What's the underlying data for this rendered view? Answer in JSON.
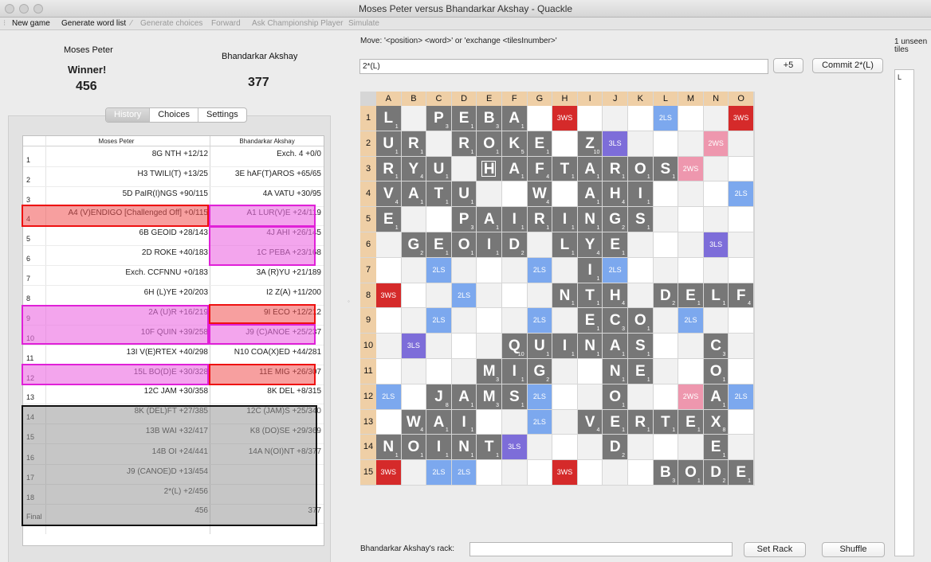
{
  "window": {
    "title": "Moses Peter versus Bhandarkar Akshay - Quackle"
  },
  "toolbar": [
    {
      "label": "New game",
      "enabled": true
    },
    {
      "label": "Generate word list",
      "enabled": true
    },
    {
      "label": "Generate choices",
      "enabled": false
    },
    {
      "label": "Forward",
      "enabled": false
    },
    {
      "label": "Ask Championship Player",
      "enabled": false
    },
    {
      "label": "Simulate",
      "enabled": false
    }
  ],
  "players": {
    "p1": {
      "name": "Moses Peter",
      "status": "Winner!",
      "score": "456"
    },
    "p2": {
      "name": "Bhandarkar Akshay",
      "score": "377"
    }
  },
  "tabs": [
    "History",
    "Choices",
    "Settings"
  ],
  "history": {
    "columns": [
      "Moses Peter",
      "Bhandarkar Akshay"
    ],
    "rows": [
      {
        "n": "1",
        "p1": "8G NTH  +12/12",
        "p2": "Exch. 4   +0/0"
      },
      {
        "n": "2",
        "p1": "H3 TWILI(T)  +13/25",
        "p2": "3E hAF(T)AROS  +65/65"
      },
      {
        "n": "3",
        "p1": "5D PaIR(I)NGS  +90/115",
        "p2": "4A VATU  +30/95"
      },
      {
        "n": "4",
        "p1": "A4 (V)ENDIGO [Challenged Off]  +0/115",
        "p2": "A1 LUR(V)E  +24/119"
      },
      {
        "n": "5",
        "p1": "6B GEOID  +28/143",
        "p2": "4J AHI  +26/145"
      },
      {
        "n": "6",
        "p1": "2D ROKE  +40/183",
        "p2": "1C PEBA  +23/168"
      },
      {
        "n": "7",
        "p1": "Exch. CCFNNU  +0/183",
        "p2": "3A (R)YU  +21/189"
      },
      {
        "n": "8",
        "p1": "6H (L)YE  +20/203",
        "p2": "I2 Z(A)  +11/200"
      },
      {
        "n": "9",
        "p1": "2A (U)R  +16/219",
        "p2": "9I ECO  +12/212"
      },
      {
        "n": "10",
        "p1": "10F QUIN  +39/258",
        "p2": "J9 (C)ANOE  +25/237"
      },
      {
        "n": "11",
        "p1": "13I V(E)RTEX  +40/298",
        "p2": "N10 COA(X)ED  +44/281"
      },
      {
        "n": "12",
        "p1": "15L BO(D)E  +30/328",
        "p2": "11E MIG  +26/307"
      },
      {
        "n": "13",
        "p1": "12C JAM  +30/358",
        "p2": "8K DEL  +8/315"
      },
      {
        "n": "14",
        "p1": "8K (DEL)FT  +27/385",
        "p2": "12C (JAM)S  +25/340"
      },
      {
        "n": "15",
        "p1": "13B WAI  +32/417",
        "p2": "K8 (DO)SE  +29/369"
      },
      {
        "n": "16",
        "p1": "14B OI  +24/441",
        "p2": "14A N(OI)NT  +8/377"
      },
      {
        "n": "17",
        "p1": "J9 (CANOE)D  +13/454",
        "p2": ""
      },
      {
        "n": "18",
        "p1": "2*(L)  +2/456",
        "p2": ""
      },
      {
        "n": "Final",
        "p1": "456",
        "p2": "377"
      }
    ]
  },
  "move": {
    "label": "Move: '<position> <word>' or 'exchange <tilesInumber>'",
    "value": "2*(L)",
    "bonus_button": "+5",
    "commit_button": "Commit 2*(L)"
  },
  "unseen": {
    "label": "1 unseen tiles",
    "tiles": "L"
  },
  "rack": {
    "label": "Bhandarkar Akshay's rack:",
    "value": "",
    "set_button": "Set Rack",
    "shuffle_button": "Shuffle"
  },
  "board": {
    "columns": [
      "A",
      "B",
      "C",
      "D",
      "E",
      "F",
      "G",
      "H",
      "I",
      "J",
      "K",
      "L",
      "M",
      "N",
      "O"
    ],
    "rows": [
      "1",
      "2",
      "3",
      "4",
      "5",
      "6",
      "7",
      "8",
      "9",
      "10",
      "11",
      "12",
      "13",
      "14",
      "15"
    ],
    "bonus_labels": {
      "TW": "3WS",
      "DW": "2WS",
      "TL": "3LS",
      "DL": "2LS"
    },
    "letter_points": {
      "A": "1",
      "B": "3",
      "C": "3",
      "D": "2",
      "E": "1",
      "F": "4",
      "G": "2",
      "H": "4",
      "I": "1",
      "J": "8",
      "K": "5",
      "L": "1",
      "M": "3",
      "N": "1",
      "O": "1",
      "P": "3",
      "Q": "10",
      "R": "1",
      "S": "1",
      "T": "1",
      "U": "1",
      "V": "4",
      "W": "4",
      "X": "8",
      "Y": "4",
      "Z": "10"
    },
    "tiles": [
      "L.PEBA.........",
      "UR.ROKE.Z......",
      "RYU.HAFTAROS...",
      "VATU..W.AHI....",
      "E..PAIRINGS....",
      ".GEOID.LYE.....",
      "........I......",
      ".......NTH.DELFT",
      "........ECO....",
      ".....QUINAS..C.",
      "....MIG..NE..O.",
      "..JAMS...O...A.",
      ".WAI....VERTEX.",
      "NOINT....D...E.",
      "...........BODE"
    ],
    "blanks": [
      "C5",
      "E3"
    ],
    "last_move": [
      "L1"
    ],
    "premium": [
      "TW..DL...TW...DL..TW",
      "DW...TL...TL...DW"
    ]
  },
  "colors": {
    "tile": "#777777",
    "tw": "#d52a2a",
    "dw": "#ee97ae",
    "tl": "#7d6dd9",
    "dl": "#7ca8ee",
    "header": "#efcfa6",
    "highlight_red": "#ee1111",
    "highlight_pink": "#e020d8"
  }
}
